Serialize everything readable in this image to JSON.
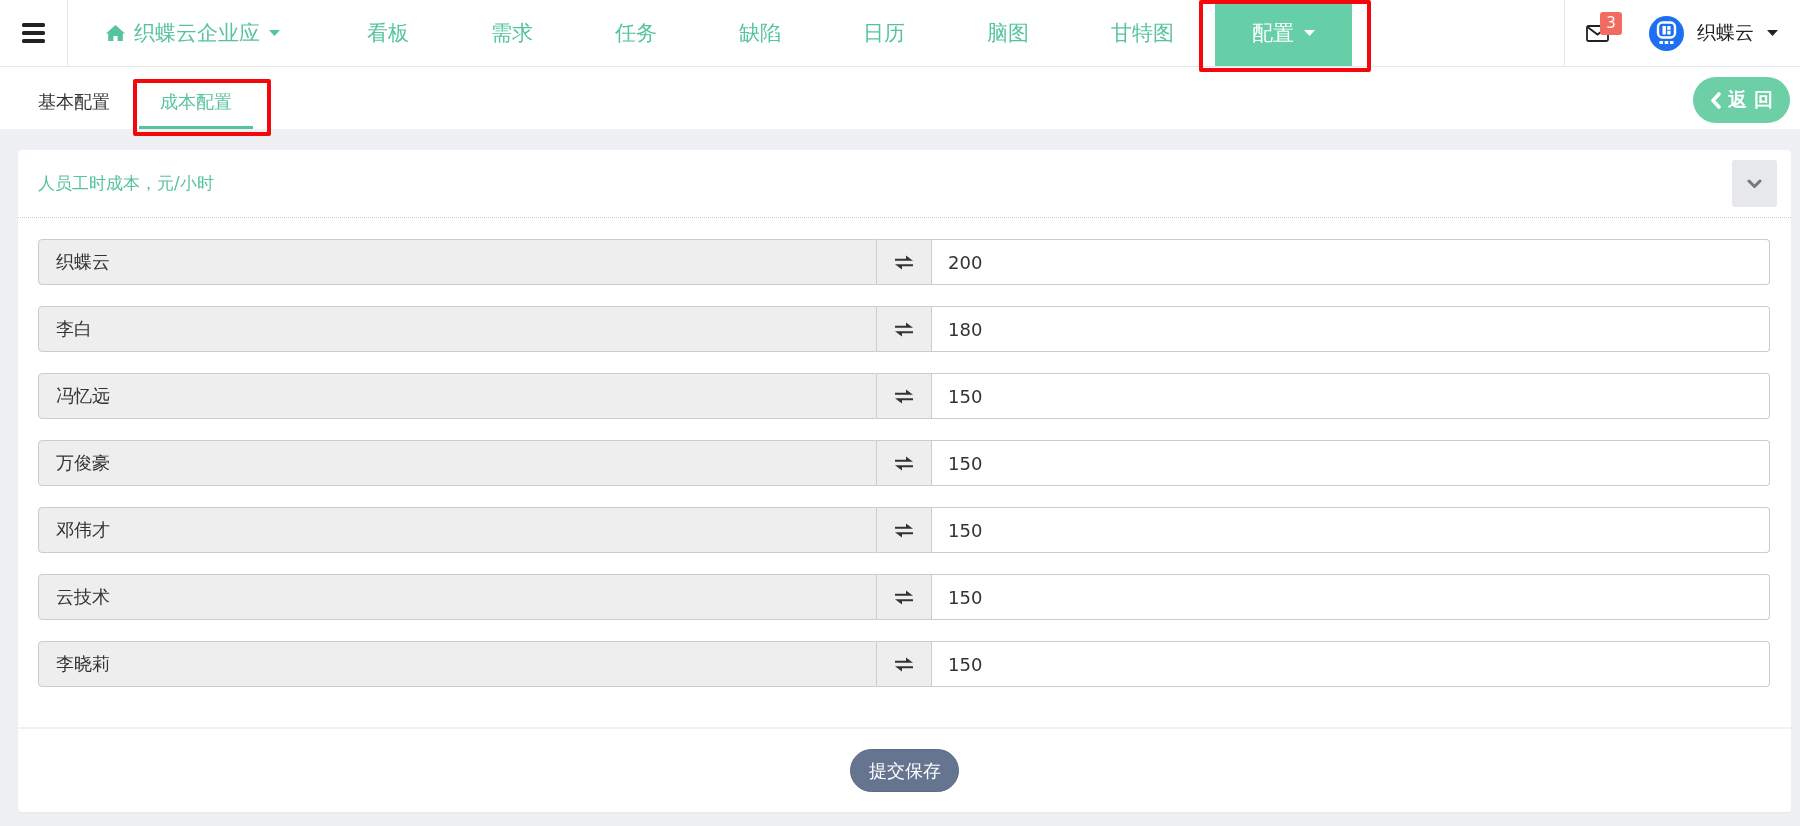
{
  "top_nav": {
    "brand": {
      "label": "织蝶云企业应",
      "dropdown": true
    },
    "items": [
      {
        "label": "看板",
        "selected": false,
        "dropdown": false,
        "annotated": false
      },
      {
        "label": "需求",
        "selected": false,
        "dropdown": false,
        "annotated": false
      },
      {
        "label": "任务",
        "selected": false,
        "dropdown": false,
        "annotated": false
      },
      {
        "label": "缺陷",
        "selected": false,
        "dropdown": false,
        "annotated": false
      },
      {
        "label": "日历",
        "selected": false,
        "dropdown": false,
        "annotated": false
      },
      {
        "label": "脑图",
        "selected": false,
        "dropdown": false,
        "annotated": false
      },
      {
        "label": "甘特图",
        "selected": false,
        "dropdown": false,
        "annotated": false
      },
      {
        "label": "配置",
        "selected": true,
        "dropdown": true,
        "annotated": true
      }
    ],
    "notifications": {
      "count": "3"
    },
    "user": {
      "name": "织蝶云",
      "dropdown": true
    }
  },
  "sub_tabs": [
    {
      "label": "基本配置",
      "selected": false,
      "annotated": false
    },
    {
      "label": "成本配置",
      "selected": true,
      "annotated": true
    }
  ],
  "back_button": {
    "label": "返 回"
  },
  "panel": {
    "title": "人员工时成本，元/小时",
    "rows": [
      {
        "name": "织蝶云",
        "value": "200"
      },
      {
        "name": "李白",
        "value": "180"
      },
      {
        "name": "冯忆远",
        "value": "150"
      },
      {
        "name": "万俊豪",
        "value": "150"
      },
      {
        "name": "邓伟才",
        "value": "150"
      },
      {
        "name": "云技术",
        "value": "150"
      },
      {
        "name": "李晓莉",
        "value": "150"
      }
    ],
    "submit_button": {
      "label": "提交保存"
    }
  }
}
